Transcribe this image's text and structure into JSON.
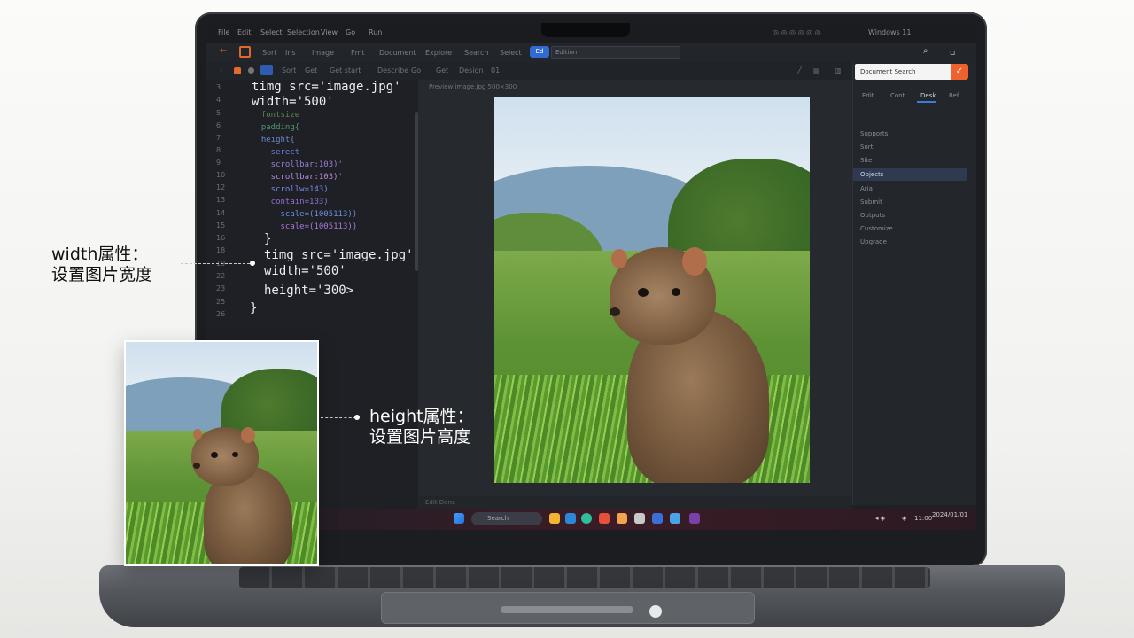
{
  "menu": [
    "File",
    "Edit",
    "Select",
    "Selection",
    "View",
    "Go",
    "Run"
  ],
  "toolbar": {
    "items": [
      "Sort",
      "Ins",
      "Image",
      "Fmt",
      "Document",
      "Explore",
      "Search",
      "Select"
    ],
    "selected_badge": "Ed",
    "dropdown_value": "Edition",
    "right_label": "Windows 11"
  },
  "toolbar2": [
    "Sort",
    "Get",
    "Get start",
    "Describe",
    "Go",
    "Get",
    "Design",
    "01"
  ],
  "line_numbers": [
    "3",
    "4",
    "5",
    "6",
    "7",
    "8",
    "9",
    "10",
    "12",
    "13",
    "14",
    "15",
    "16",
    "18",
    "19",
    "22",
    "23",
    "25",
    "26"
  ],
  "code_lines": [
    {
      "text": "timg src='image.jpg'",
      "color": "#e9ecf0",
      "size": 14
    },
    {
      "text": "width='500'",
      "color": "#e9ecf0",
      "size": 14
    },
    {
      "text": "  fontsize",
      "color": "#5a8f4a",
      "size": 9
    },
    {
      "text": "  padding{",
      "color": "#4c9a6a",
      "size": 9
    },
    {
      "text": "  height{",
      "color": "#6b86c7",
      "size": 9
    },
    {
      "text": "    serect",
      "color": "#6c7ad6",
      "size": 9
    },
    {
      "text": "    scrollbar:103)'",
      "color": "#9a7fd1",
      "size": 9
    },
    {
      "text": "    scrollbar:103)'",
      "color": "#b58ad8",
      "size": 9
    },
    {
      "text": "    scrollw=143)",
      "color": "#7a86e0",
      "size": 9
    },
    {
      "text": "    contain=103)",
      "color": "#8e6fd0",
      "size": 9
    },
    {
      "text": "      scale=(1005113))",
      "color": "#6b8fe0",
      "size": 9
    },
    {
      "text": "      scale=(1005113))",
      "color": "#a77ad8",
      "size": 9
    },
    {
      "text": "}",
      "color": "#e9ecf0",
      "size": 14
    },
    {
      "text": "timg src='image.jpg'",
      "color": "#e9ecf0",
      "size": 14
    },
    {
      "text": "width='500'",
      "color": "#e9ecf0",
      "size": 14
    },
    {
      "text": "height='300>",
      "color": "#e9ecf0",
      "size": 14
    },
    {
      "text": "}",
      "color": "#e9ecf0",
      "size": 14
    }
  ],
  "preview_label": "Preview image.jpg 500×300",
  "right_panel": {
    "search_placeholder": "Document Search",
    "search_button": "✓",
    "tabs": [
      "Edit",
      "Cont",
      "Desk",
      "Ref"
    ],
    "items": [
      "Supports",
      "Sort",
      "Site",
      "Objects",
      "Aria",
      "Submit",
      "Outputs",
      "Customize",
      "Upgrade"
    ],
    "selected_index": 3
  },
  "status_left": "Edit Done",
  "taskbar": {
    "search": "Search",
    "time": "11:00",
    "date": "2024/01/01"
  },
  "callouts": {
    "width_title": "width属性：",
    "width_desc": "设置图片宽度",
    "height_title": "height属性：",
    "height_desc": "设置图片高度"
  },
  "icons": [
    "back-arrow-icon",
    "home-icon",
    "search-icon",
    "windows-icon",
    "folder-icon",
    "browser-icon",
    "store-icon",
    "photos-icon",
    "mail-icon",
    "wifi-icon",
    "volume-icon",
    "battery-icon"
  ]
}
